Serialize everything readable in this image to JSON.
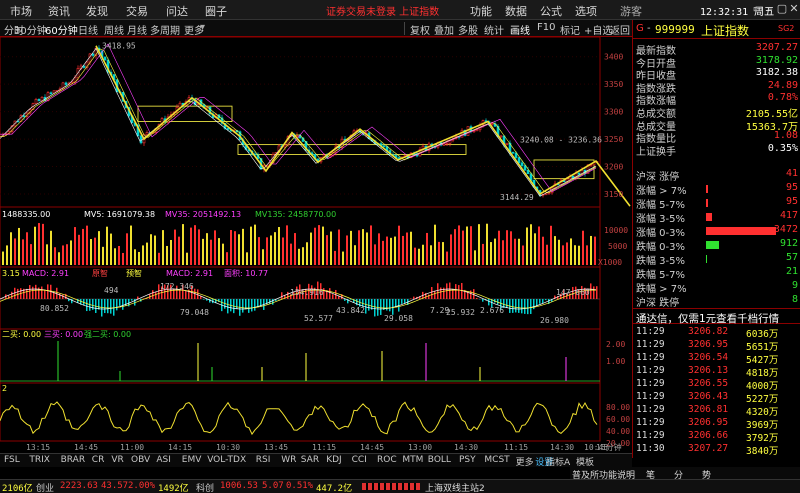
{
  "menu": {
    "items": [
      "市场",
      "资讯",
      "发现",
      "交易",
      "问达",
      "圈子"
    ],
    "center_message": "证券交易未登录  上证指数",
    "right_items": [
      "功能",
      "数据",
      "公式",
      "选项"
    ],
    "user": "游客",
    "clock": "12:32:31 周五",
    "window_buttons": [
      "▭",
      "–",
      "▢",
      "✕"
    ]
  },
  "toolbar": {
    "left": [
      "分时",
      "30分钟",
      "60分钟",
      "日线",
      "周线",
      "月线",
      "多周期",
      "更多"
    ],
    "right": [
      "复权",
      "叠加",
      "多股",
      "统计",
      "画线",
      "F10",
      "标记",
      "+自选",
      "返回"
    ],
    "selected_left": "60分钟",
    "selected_right": "画线"
  },
  "chart_data": {
    "type": "candlestick",
    "y_axis_price": [
      "3400",
      "3350",
      "3300",
      "3250",
      "3200",
      "3150"
    ],
    "price_range": [
      3130,
      3425
    ],
    "annotations": {
      "high": "3418.95",
      "low": "3144.29",
      "range": "3240.08 - 3236.36"
    },
    "volume_legend": {
      "vol": "1488335.00",
      "ma5": "MV5: 1691079.38",
      "ma35": "MV35: 2051492.13",
      "ma135": "MV135: 2458770.00"
    },
    "volume_axis": [
      "10000",
      "5000",
      "X1000"
    ],
    "macd_legend": {
      "a": "3.15",
      "b": "MACD: 2.91",
      "c": "原智",
      "d": "预智",
      "e": "MACD: 2.91",
      "f": "面积: 10.77"
    },
    "macd_values": [
      "494",
      "172.346",
      "154.916",
      "147.660",
      "80.852",
      "79.048",
      "52.577",
      "26.980",
      "43.842",
      "7.29",
      "25.932",
      "2.676",
      "29.058"
    ],
    "signal_legend": {
      "a": "二买: 0.00",
      "b": "三买: 0.00",
      "c": "强二买: 0.00"
    },
    "signal_axis": [
      "2.00",
      "1.00"
    ],
    "osc_axis": [
      "80.00",
      "60.00",
      "40.00",
      "20.00"
    ],
    "osc_label": "2",
    "time_axis": [
      "13:15",
      "14:45",
      "11:00",
      "14:15",
      "10:30",
      "13:45",
      "11:15",
      "14:45",
      "13:00",
      "14:30",
      "11:15",
      "14:30",
      "10:45",
      "15分钟"
    ]
  },
  "panel": {
    "code": "999999",
    "name": "上证指数",
    "badge": "SG2",
    "quote_rows": [
      {
        "label": "最新指数",
        "value": "3207.27",
        "color": "#ff3030"
      },
      {
        "label": "今日开盘",
        "value": "3178.92",
        "color": "#30e030"
      },
      {
        "label": "昨日收盘",
        "value": "3182.38",
        "color": "#ffffff"
      },
      {
        "label": "指数涨跌",
        "value": "24.89",
        "color": "#ff3030"
      },
      {
        "label": "指数涨幅",
        "value": "0.78%",
        "color": "#ff3030"
      },
      {
        "label": "总成交额",
        "value": "2105.55亿",
        "color": "#ffff40"
      },
      {
        "label": "总成交量",
        "value": "15363.7万",
        "color": "#ffff40"
      },
      {
        "label": "指数量比",
        "value": "1.08",
        "color": "#ff3030"
      },
      {
        "label": "上证换手",
        "value": "0.35%",
        "color": "#ffffff"
      }
    ],
    "stat_rows": [
      {
        "label": "沪深 涨停",
        "value": "41",
        "color": "#ff3030",
        "bar": 0
      },
      {
        "label": "涨幅 > 7%",
        "value": "95",
        "color": "#ff3030",
        "bar": 2
      },
      {
        "label": "涨幅 5-7%",
        "value": "95",
        "color": "#ff3030",
        "bar": 2
      },
      {
        "label": "涨幅 3-5%",
        "value": "417",
        "color": "#ff3030",
        "bar": 8
      },
      {
        "label": "涨幅 0-3%",
        "value": "3472",
        "color": "#ff3030",
        "bar": 88
      },
      {
        "label": "跌幅 0-3%",
        "value": "912",
        "color": "#30e030",
        "bar": 16
      },
      {
        "label": "跌幅 3-5%",
        "value": "57",
        "color": "#30e030",
        "bar": 1
      },
      {
        "label": "跌幅 5-7%",
        "value": "21",
        "color": "#30e030",
        "bar": 0
      },
      {
        "label": "跌幅 > 7%",
        "value": "9",
        "color": "#30e030",
        "bar": 0
      },
      {
        "label": "沪深 跌停",
        "value": "8",
        "color": "#30e030",
        "bar": 0
      }
    ],
    "banner": "通达信，仅需1元查看千档行情",
    "ticks": [
      {
        "time": "11:29",
        "price": "3206.82",
        "vol": "6036万"
      },
      {
        "time": "11:29",
        "price": "3206.95",
        "vol": "5651万"
      },
      {
        "time": "11:29",
        "price": "3206.54",
        "vol": "5427万"
      },
      {
        "time": "11:29",
        "price": "3206.13",
        "vol": "4818万"
      },
      {
        "time": "11:29",
        "price": "3206.55",
        "vol": "4000万"
      },
      {
        "time": "11:29",
        "price": "3206.43",
        "vol": "5227万"
      },
      {
        "time": "11:29",
        "price": "3206.81",
        "vol": "4320万"
      },
      {
        "time": "11:29",
        "price": "3206.95",
        "vol": "3969万"
      },
      {
        "time": "11:29",
        "price": "3206.66",
        "vol": "3792万"
      },
      {
        "time": "11:30",
        "price": "3207.27",
        "vol": "3840万"
      }
    ]
  },
  "tabs": {
    "items": [
      "FSL",
      "TRIX",
      "BRAR",
      "CR",
      "VR",
      "OBV",
      "ASI",
      "EMV",
      "VOL-TDX",
      "RSI",
      "WR",
      "SAR",
      "KDJ",
      "CCI",
      "ROC",
      "MTM",
      "BOLL",
      "PSY",
      "MCST",
      "更多",
      "设置"
    ],
    "selected": "设置",
    "right_a": "指标A",
    "right_b": "模板",
    "right2": [
      "普及所功能说明",
      "笔",
      "分",
      "势"
    ]
  },
  "status": {
    "idx1": "2106亿",
    "name2": "创业",
    "val2": "2223.63",
    "chg2": "43.57",
    "pct2": "2.00%",
    "amt2": "1492亿",
    "name3": "科创",
    "val3": "1006.53",
    "chg3": "5.07",
    "pct3": "0.51%",
    "amt3": "447.2亿",
    "server": "上海双线主站2"
  }
}
